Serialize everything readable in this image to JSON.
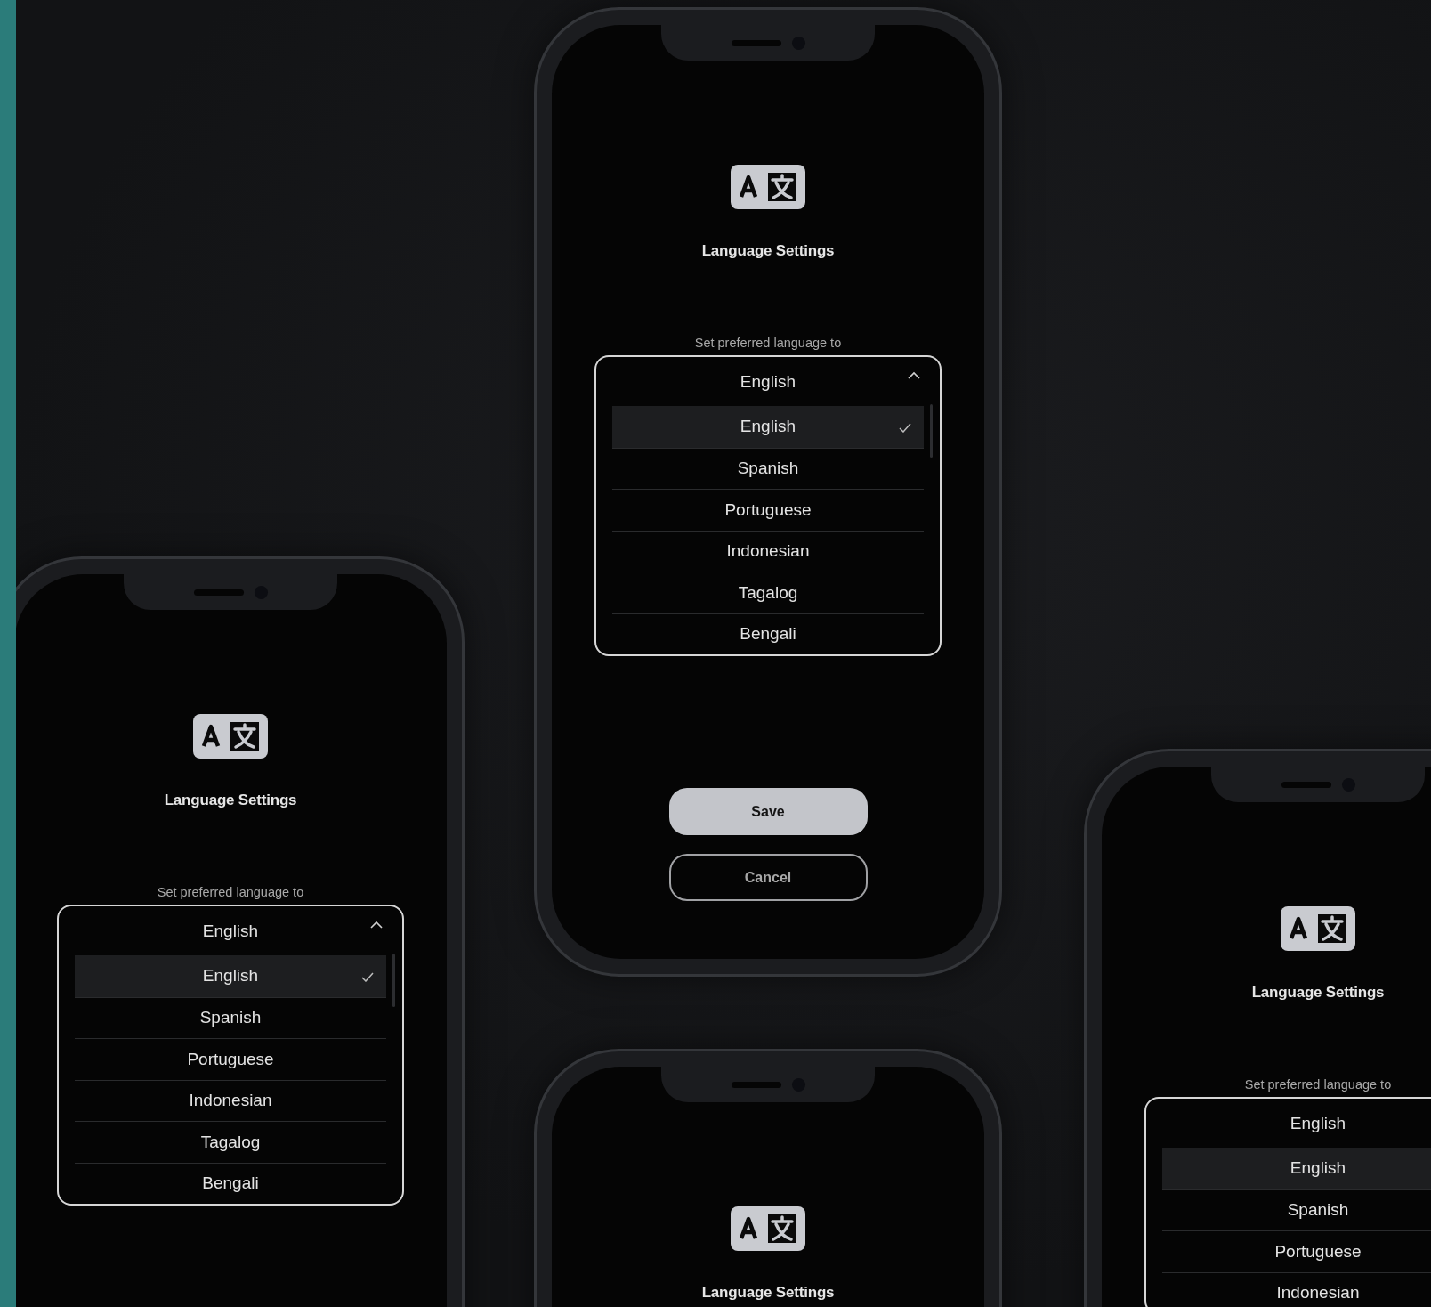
{
  "phones": [
    {
      "title": "Language Settings",
      "label": "Set preferred language to",
      "dropdown": {
        "value": "English",
        "expanded": true,
        "options": [
          {
            "label": "English",
            "selected": true
          },
          {
            "label": "Spanish",
            "selected": false
          },
          {
            "label": "Portuguese",
            "selected": false
          },
          {
            "label": "Indonesian",
            "selected": false
          },
          {
            "label": "Tagalog",
            "selected": false
          },
          {
            "label": "Bengali",
            "selected": false
          }
        ]
      },
      "buttons": [
        {
          "label": "Save",
          "kind": "primary"
        },
        {
          "label": "Cancel",
          "kind": "secondary"
        }
      ]
    },
    {
      "title": "Language Settings",
      "label": "Set preferred language to",
      "dropdown": {
        "value": "English",
        "expanded": true,
        "options": [
          {
            "label": "English",
            "selected": true
          },
          {
            "label": "Spanish",
            "selected": false
          },
          {
            "label": "Portuguese",
            "selected": false
          },
          {
            "label": "Indonesian",
            "selected": false
          },
          {
            "label": "Tagalog",
            "selected": false
          },
          {
            "label": "Bengali",
            "selected": false
          }
        ]
      }
    },
    {
      "title": "Language Settings"
    },
    {
      "title": "Language Settings",
      "label": "Set preferred language to",
      "dropdown": {
        "value": "English",
        "options": [
          {
            "label": "English",
            "selected": true
          },
          {
            "label": "Spanish",
            "selected": false
          },
          {
            "label": "Portuguese",
            "selected": false
          },
          {
            "label": "Indonesian",
            "selected": false
          }
        ]
      }
    }
  ]
}
